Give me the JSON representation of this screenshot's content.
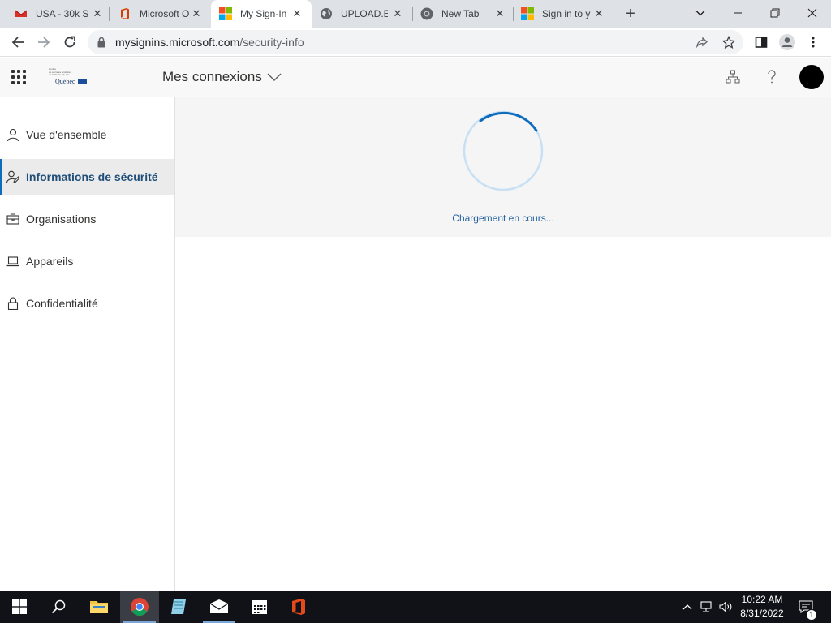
{
  "browser": {
    "tabs": [
      {
        "title": "USA - 30k S",
        "favicon": "red-envelope-icon"
      },
      {
        "title": "Microsoft O",
        "favicon": "office-icon"
      },
      {
        "title": "My Sign-In",
        "favicon": "microsoft-logo-icon",
        "active": true
      },
      {
        "title": "UPLOAD.EE",
        "favicon": "globe-icon"
      },
      {
        "title": "New Tab",
        "favicon": "chrome-icon"
      },
      {
        "title": "Sign in to y",
        "favicon": "microsoft-logo-icon"
      }
    ],
    "new_tab_label": "+",
    "url_host": "mysignins.microsoft.com",
    "url_path": "/security-info"
  },
  "header": {
    "app_title": "Mes connexions",
    "org_logo_text": "Québec",
    "org_logo_small": [
      "Centre",
      "de services scolaires",
      "de la Pointe-de-l'Île",
      ""
    ]
  },
  "sidebar": {
    "items": [
      {
        "label": "Vue d'ensemble",
        "icon": "person-icon"
      },
      {
        "label": "Informations de sécurité",
        "icon": "security-info-icon",
        "selected": true
      },
      {
        "label": "Organisations",
        "icon": "briefcase-icon"
      },
      {
        "label": "Appareils",
        "icon": "laptop-icon"
      },
      {
        "label": "Confidentialité",
        "icon": "lock-icon"
      }
    ]
  },
  "main": {
    "loading_text": "Chargement en cours..."
  },
  "taskbar": {
    "apps": [
      "start-icon",
      "search-icon",
      "file-explorer-icon",
      "chrome-icon",
      "notepad-icon",
      "mail-icon",
      "calendar-icon",
      "office-icon"
    ],
    "time": "10:22 AM",
    "date": "8/31/2022",
    "notification_count": "1"
  },
  "colors": {
    "accent": "#0f6cbd",
    "selected_text": "#1f4e79",
    "loading_text": "#1f5e9e",
    "taskbar": "#101218"
  }
}
